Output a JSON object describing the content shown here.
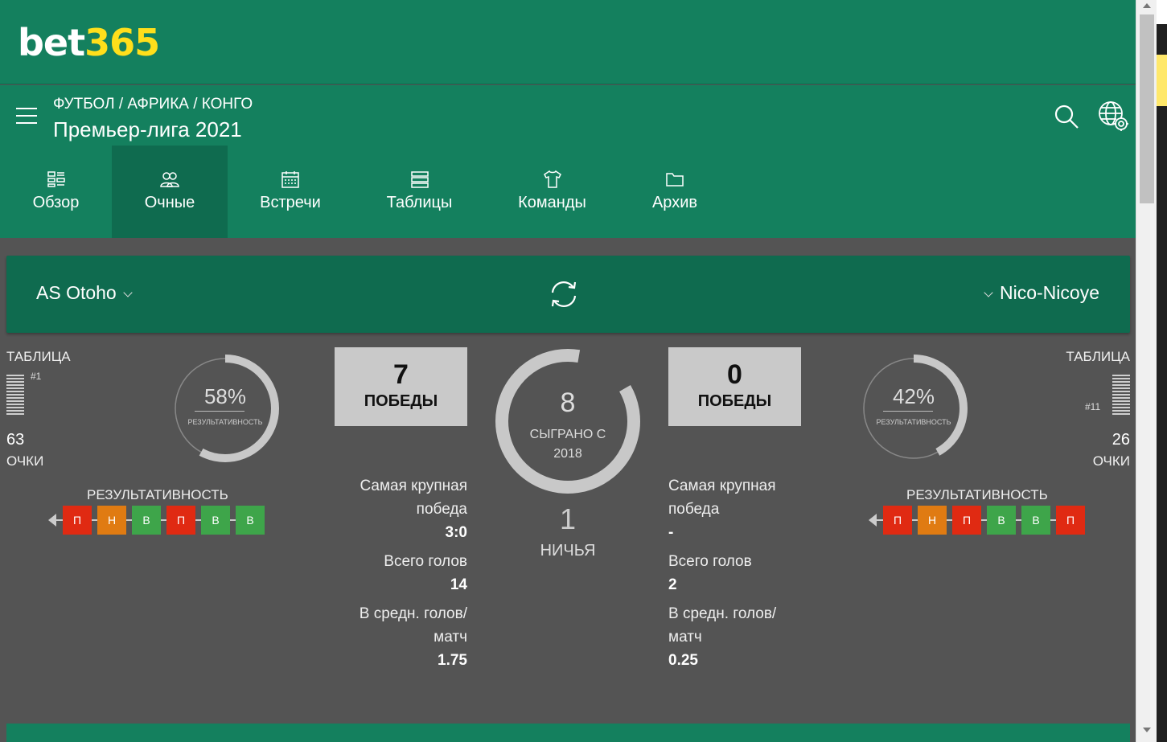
{
  "header": {
    "logo_part1": "bet",
    "logo_part2": "365",
    "breadcrumb": "ФУТБОЛ / АФРИКА / КОНГО",
    "league": "Премьер-лига 2021"
  },
  "tabs": [
    {
      "label": "Обзор",
      "icon": "overview-icon"
    },
    {
      "label": "Очные",
      "icon": "h2h-icon",
      "active": true
    },
    {
      "label": "Встречи",
      "icon": "calendar-icon"
    },
    {
      "label": "Таблицы",
      "icon": "table-icon"
    },
    {
      "label": "Команды",
      "icon": "shirt-icon"
    },
    {
      "label": "Архив",
      "icon": "folder-icon"
    }
  ],
  "selector": {
    "home_team": "AS Otoho",
    "away_team": "Nico-Nicoye"
  },
  "home": {
    "table_label": "ТАБЛИЦА",
    "position": "#1",
    "points": "63",
    "points_label": "ОЧКИ",
    "performance_pct": "58%",
    "performance_value": 0.58,
    "performance_sub": "РЕЗУЛЬТАТИВНОСТЬ",
    "form_title": "РЕЗУЛЬТАТИВНОСТЬ",
    "form": [
      {
        "r": "П",
        "type": "l"
      },
      {
        "r": "Н",
        "type": "d"
      },
      {
        "r": "В",
        "type": "w"
      },
      {
        "r": "П",
        "type": "l"
      },
      {
        "r": "В",
        "type": "w"
      },
      {
        "r": "В",
        "type": "w"
      }
    ],
    "wins": "7",
    "wins_label": "ПОБЕДЫ",
    "biggest_win_label": "Самая крупная победа",
    "biggest_win": "3:0",
    "total_goals_label": "Всего голов",
    "total_goals": "14",
    "avg_goals_label": "В средн. голов/ матч",
    "avg_goals": "1.75"
  },
  "away": {
    "table_label": "ТАБЛИЦА",
    "position": "#11",
    "points": "26",
    "points_label": "ОЧКИ",
    "performance_pct": "42%",
    "performance_value": 0.42,
    "performance_sub": "РЕЗУЛЬТАТИВНОСТЬ",
    "form_title": "РЕЗУЛЬТАТИВНОСТЬ",
    "form": [
      {
        "r": "П",
        "type": "l"
      },
      {
        "r": "Н",
        "type": "d"
      },
      {
        "r": "П",
        "type": "l"
      },
      {
        "r": "В",
        "type": "w"
      },
      {
        "r": "В",
        "type": "w"
      },
      {
        "r": "П",
        "type": "l"
      }
    ],
    "wins": "0",
    "wins_label": "ПОБЕДЫ",
    "biggest_win_label": "Самая крупная победа",
    "biggest_win": "-",
    "total_goals_label": "Всего голов",
    "total_goals": "2",
    "avg_goals_label": "В средн. голов/ матч",
    "avg_goals": "0.25"
  },
  "center": {
    "played": "8",
    "played_label": "СЫГРАНО С",
    "since": "2018",
    "draws": "1",
    "draws_label": "НИЧЬЯ"
  },
  "colors": {
    "green": "#14805e",
    "dark_green": "#0f6b4f",
    "yellow": "#ffdf1b",
    "loss": "#e02a12",
    "draw": "#e07b12",
    "win": "#3ea54a"
  }
}
